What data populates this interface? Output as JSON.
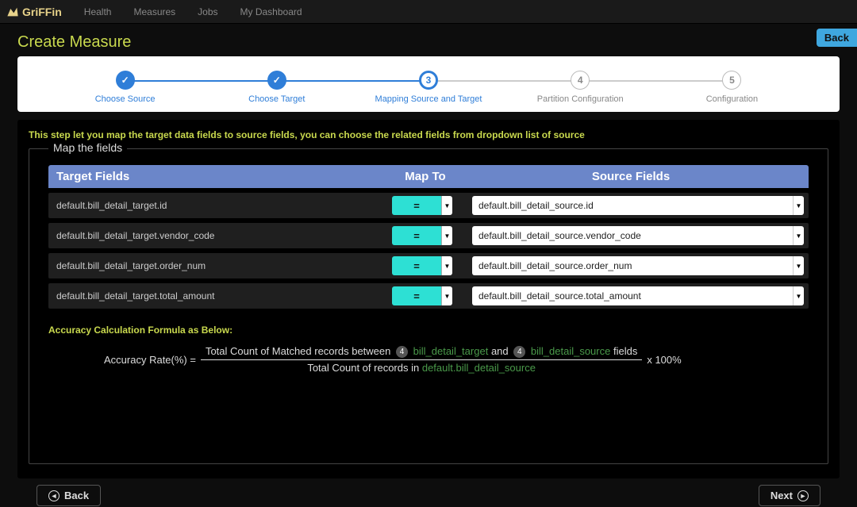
{
  "brand": "GriFFin",
  "nav": [
    "Health",
    "Measures",
    "Jobs",
    "My Dashboard"
  ],
  "page_title": "Create Measure",
  "back_pill": "Back",
  "steps": [
    {
      "num": "✓",
      "label": "Choose Source",
      "state": "done"
    },
    {
      "num": "✓",
      "label": "Choose Target",
      "state": "done"
    },
    {
      "num": "3",
      "label": "Mapping Source and Target",
      "state": "active"
    },
    {
      "num": "4",
      "label": "Partition Configuration",
      "state": "pending"
    },
    {
      "num": "5",
      "label": "Configuration",
      "state": "pending"
    }
  ],
  "intro": "This step let you map the target data fields to source fields, you can choose the related fields from dropdown list of source",
  "fieldset_legend": "Map the fields",
  "headers": {
    "target": "Target Fields",
    "map": "Map To",
    "source": "Source Fields"
  },
  "rows": [
    {
      "target": "default.bill_detail_target.id",
      "op": "=",
      "source": "default.bill_detail_source.id"
    },
    {
      "target": "default.bill_detail_target.vendor_code",
      "op": "=",
      "source": "default.bill_detail_source.vendor_code"
    },
    {
      "target": "default.bill_detail_target.order_num",
      "op": "=",
      "source": "default.bill_detail_source.order_num"
    },
    {
      "target": "default.bill_detail_target.total_amount",
      "op": "=",
      "source": "default.bill_detail_source.total_amount"
    }
  ],
  "formula_title": "Accuracy Calculation Formula as Below:",
  "formula": {
    "lhs": "Accuracy Rate(%) =",
    "top_a": "Total Count of Matched records between",
    "badge1": "4",
    "tgt": "bill_detail_target",
    "and": "and",
    "badge2": "4",
    "src": "bill_detail_source",
    "top_b": "fields",
    "bot_a": "Total Count of records in",
    "bot_b": "default.bill_detail_source",
    "suffix": "x 100%"
  },
  "footer": {
    "back": "Back",
    "next": "Next"
  }
}
